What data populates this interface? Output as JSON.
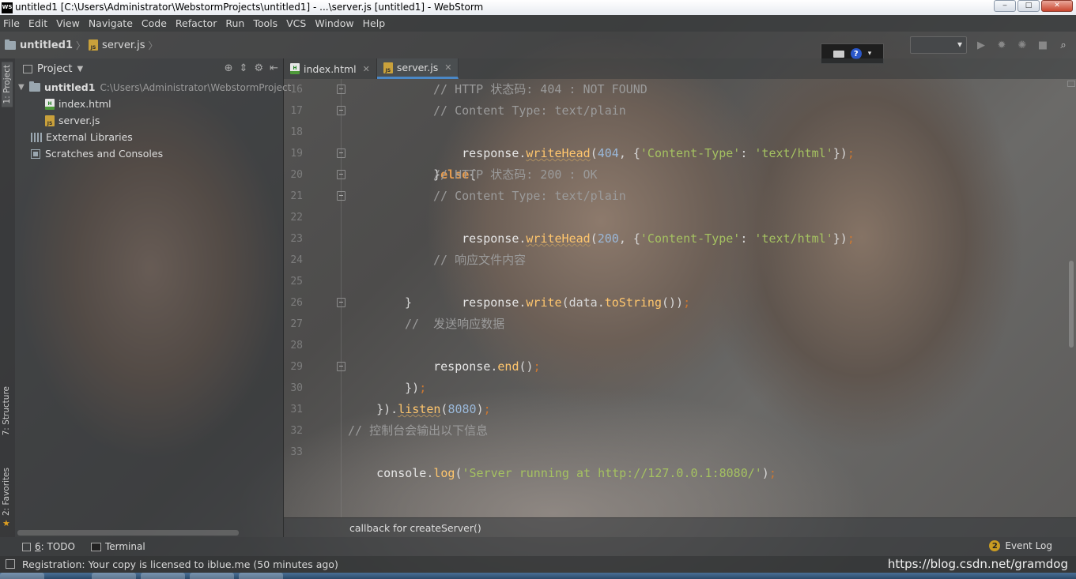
{
  "window": {
    "logo": "WS",
    "title": "untitled1 [C:\\Users\\Administrator\\WebstormProjects\\untitled1] - ...\\server.js [untitled1] - WebStorm",
    "controls": {
      "minimize": "‒",
      "maximize": "□",
      "close": "✕"
    }
  },
  "menu": [
    "File",
    "Edit",
    "View",
    "Navigate",
    "Code",
    "Refactor",
    "Run",
    "Tools",
    "VCS",
    "Window",
    "Help"
  ],
  "nav": {
    "project": "untitled1",
    "file": "server.js"
  },
  "left_strip": {
    "project_tab": "1: Project",
    "structure_tab": "7: Structure",
    "favorites_tab": "2: Favorites"
  },
  "project_panel": {
    "title": "Project",
    "root": {
      "name": "untitled1",
      "path": "C:\\Users\\Administrator\\WebstormProject"
    },
    "files": [
      "index.html",
      "server.js"
    ],
    "external_libraries": "External Libraries",
    "scratches": "Scratches and Consoles"
  },
  "tabs": [
    {
      "label": "index.html",
      "active": false
    },
    {
      "label": "server.js",
      "active": true
    }
  ],
  "line_numbers": [
    "16",
    "17",
    "18",
    "19",
    "20",
    "21",
    "22",
    "23",
    "24",
    "25",
    "26",
    "27",
    "28",
    "29",
    "30",
    "31",
    "32",
    "33"
  ],
  "code": {
    "l16": "// HTTP 状态码: 404 : NOT FOUND",
    "l17": "// Content Type: text/plain",
    "l18": {
      "obj": "response",
      "dot": ".",
      "fn": "writeHead",
      "open": "(",
      "num": "404",
      "mid": ", {",
      "key": "'Content-Type'",
      "colon": ": ",
      "val": "'text/html'",
      "close": "})",
      "semi": ";"
    },
    "l19": {
      "brace": "}",
      "kw": "else",
      "open": "{"
    },
    "l20": "// HTTP 状态码: 200 : OK",
    "l21": "// Content Type: text/plain",
    "l22": {
      "obj": "response",
      "dot": ".",
      "fn": "writeHead",
      "open": "(",
      "num": "200",
      "mid": ", {",
      "key": "'Content-Type'",
      "colon": ": ",
      "val": "'text/html'",
      "close": "})",
      "semi": ";"
    },
    "l24": "// 响应文件内容",
    "l25": {
      "obj": "response",
      "dot": ".",
      "fn": "write",
      "open": "(data.",
      "fn2": "toString",
      "close": "())",
      "semi": ";"
    },
    "l26": "}",
    "l27": "//  发送响应数据",
    "l28": {
      "obj": "response",
      "dot": ".",
      "fn": "end",
      "close": "()",
      "semi": ";"
    },
    "l29": {
      "close": "})",
      "semi": ";"
    },
    "l30": {
      "pre": "}).",
      "fn": "listen",
      "open": "(",
      "num": "8080",
      "close": ")",
      "semi": ";"
    },
    "l32": "// 控制台会输出以下信息",
    "l33": {
      "obj": "console",
      "dot": ".",
      "fn": "log",
      "open": "(",
      "str": "'Server running at http://127.0.0.1:8080/'",
      "close": ")",
      "semi": ";"
    }
  },
  "breadcrumb": "callback for createServer()",
  "bottom_tools": {
    "todo_num": "6",
    "todo_label": ": TODO",
    "terminal": "Terminal",
    "event_log": "Event Log",
    "event_count": "2"
  },
  "status": {
    "message": "Registration: Your copy is licensed to iblue.me (50 minutes ago)",
    "watermark": "https://blog.csdn.net/gramdog"
  }
}
